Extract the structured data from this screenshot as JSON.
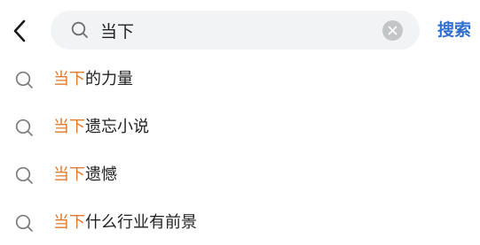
{
  "header": {
    "back_icon": "chevron-left-icon",
    "search": {
      "icon": "search-icon",
      "value": "当下",
      "placeholder": "",
      "clear_icon": "clear-icon"
    },
    "action_label": "搜索"
  },
  "colors": {
    "highlight": "#e07a2c",
    "action": "#2f6fcf",
    "search_background": "#f2f3f5"
  },
  "suggestions": [
    {
      "icon": "search-icon",
      "match": "当下",
      "rest": "的力量"
    },
    {
      "icon": "search-icon",
      "match": "当下",
      "rest": "遗忘小说"
    },
    {
      "icon": "search-icon",
      "match": "当下",
      "rest": "遗憾"
    },
    {
      "icon": "search-icon",
      "match": "当下",
      "rest": "什么行业有前景"
    }
  ]
}
